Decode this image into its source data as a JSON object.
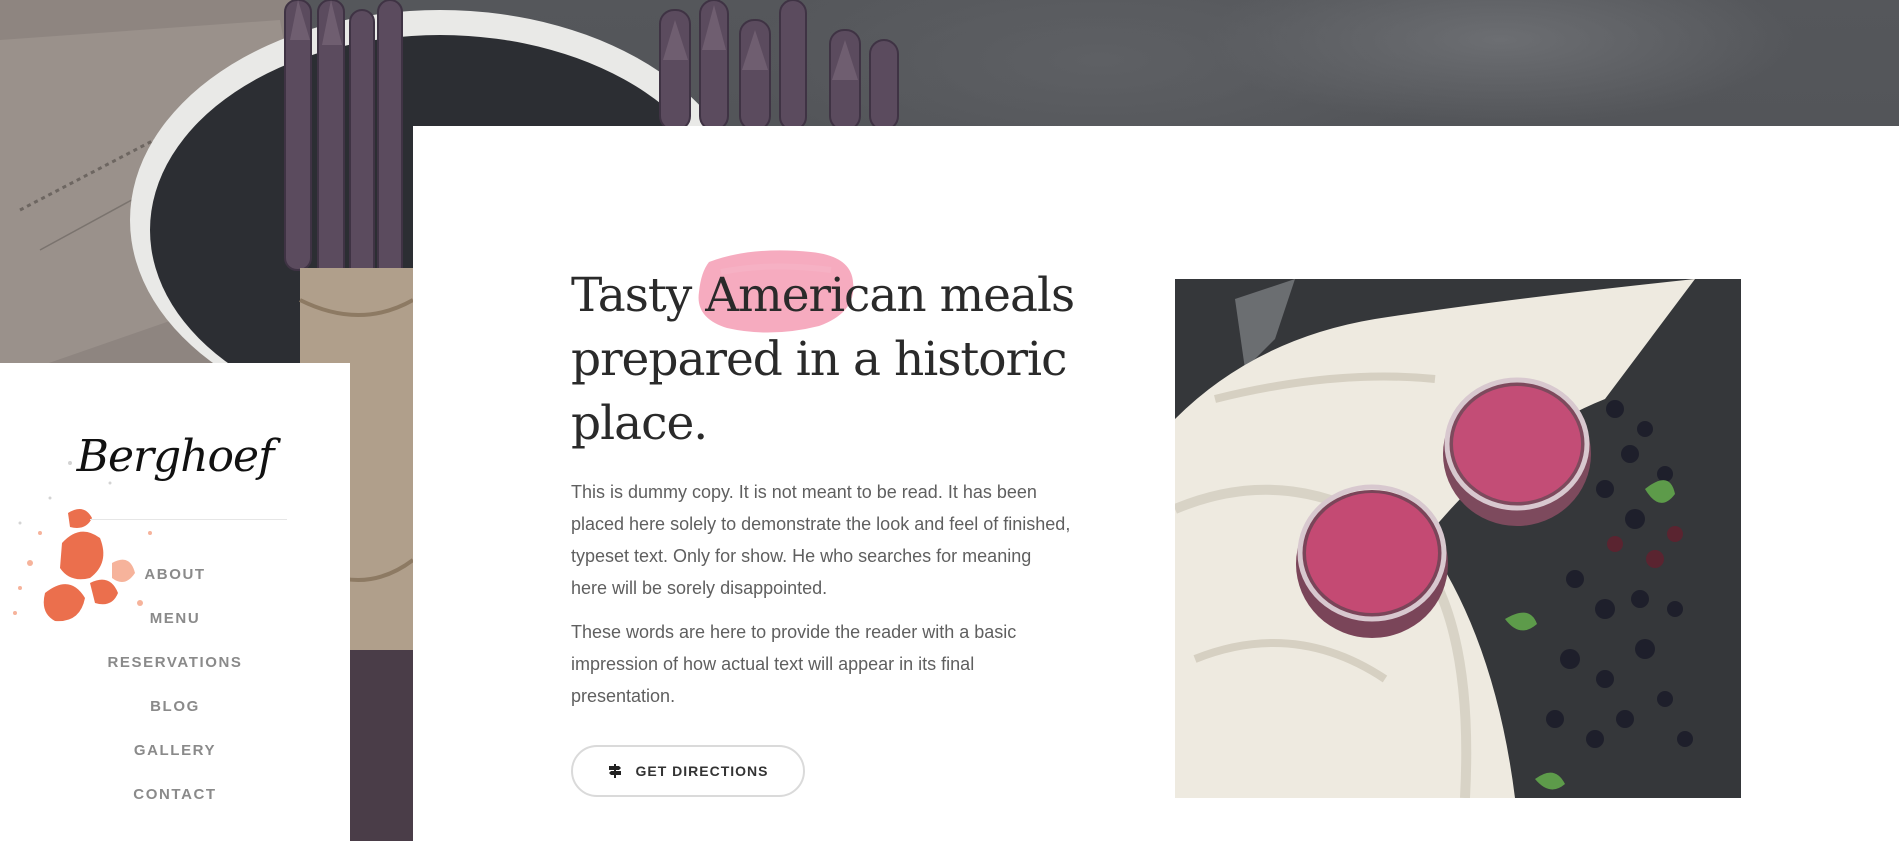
{
  "brand": {
    "logo_text": "Berghoef"
  },
  "nav": {
    "items": [
      {
        "label": "ABOUT"
      },
      {
        "label": "MENU"
      },
      {
        "label": "RESERVATIONS"
      },
      {
        "label": "BLOG"
      },
      {
        "label": "GALLERY"
      },
      {
        "label": "CONTACT"
      }
    ]
  },
  "content": {
    "headline": "Tasty American meals prepared in a historic place.",
    "paragraph_1": "This is dummy copy. It is not meant to be read. It has been placed here solely to demonstrate the look and feel of finished, typeset text. Only for show. He who searches for meaning here will be sorely disappointed.",
    "paragraph_2": "These words are here to provide the reader with a basic impression of how actual text will appear in its final presentation.",
    "directions_button": {
      "label": "GET DIRECTIONS",
      "icon": "signpost-icon"
    }
  },
  "colors": {
    "highlight_brush": "#f28aa6",
    "splatter": "#e8562e",
    "text_dark": "#2a2a2a",
    "text_body": "#5f5f5f",
    "nav_text": "#8a8a8a"
  }
}
